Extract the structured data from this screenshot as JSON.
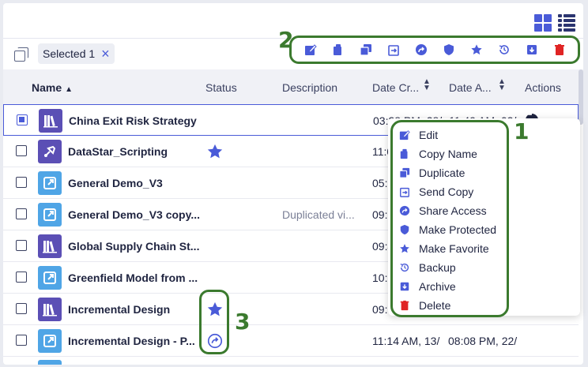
{
  "toolbar": {
    "selected_chip": "Selected 1",
    "chip_close": "×",
    "icons": [
      "edit-icon",
      "copy-icon",
      "duplicate-icon",
      "send-copy-icon",
      "share-icon",
      "shield-icon",
      "star-icon",
      "backup-icon",
      "archive-icon",
      "delete-icon"
    ]
  },
  "table": {
    "headers": {
      "name": "Name",
      "status": "Status",
      "description": "Description",
      "date_created": "Date Cr...",
      "date_accessed": "Date A...",
      "actions": "Actions"
    },
    "rows": [
      {
        "name": "China Exit Risk Strategy",
        "icon": "library-icon",
        "status": "",
        "description": "",
        "date_created": "03:38 PM, 28/",
        "date_accessed": "11:49 AM, 02/",
        "selected": true
      },
      {
        "name": "DataStar_Scripting",
        "icon": "rocket-icon",
        "status": "favorite",
        "description": "",
        "date_created": "11:0",
        "date_accessed": "",
        "selected": false
      },
      {
        "name": "General Demo_V3",
        "icon": "external-link-icon",
        "status": "",
        "description": "",
        "date_created": "05:1",
        "date_accessed": "",
        "selected": false
      },
      {
        "name": "General Demo_V3 copy...",
        "icon": "external-link-icon",
        "status": "",
        "description": "Duplicated vi...",
        "date_created": "09:5",
        "date_accessed": "",
        "selected": false
      },
      {
        "name": "Global Supply Chain St...",
        "icon": "library-icon",
        "status": "",
        "description": "",
        "date_created": "09:4",
        "date_accessed": "",
        "selected": false
      },
      {
        "name": "Greenfield Model from ...",
        "icon": "external-link-icon",
        "status": "",
        "description": "",
        "date_created": "10:2",
        "date_accessed": "",
        "selected": false
      },
      {
        "name": "Incremental Design",
        "icon": "library-icon",
        "status": "favorite",
        "description": "",
        "date_created": "09:5",
        "date_accessed": "",
        "selected": false
      },
      {
        "name": "Incremental Design - P...",
        "icon": "external-link-icon",
        "status": "shared",
        "description": "",
        "date_created": "11:14 AM, 13/",
        "date_accessed": "08:08 PM, 22/",
        "selected": false
      }
    ]
  },
  "context_menu": {
    "items": [
      {
        "label": "Edit",
        "icon": "edit-icon"
      },
      {
        "label": "Copy Name",
        "icon": "copy-icon"
      },
      {
        "label": "Duplicate",
        "icon": "duplicate-icon"
      },
      {
        "label": "Send Copy",
        "icon": "send-copy-icon"
      },
      {
        "label": "Share Access",
        "icon": "share-icon"
      },
      {
        "label": "Make Protected",
        "icon": "shield-icon"
      },
      {
        "label": "Make Favorite",
        "icon": "star-icon"
      },
      {
        "label": "Backup",
        "icon": "backup-icon"
      },
      {
        "label": "Archive",
        "icon": "archive-icon"
      },
      {
        "label": "Delete",
        "icon": "delete-icon"
      }
    ]
  },
  "callouts": {
    "one": "1",
    "two": "2",
    "three": "3"
  },
  "colors": {
    "accent": "#4a5bd8",
    "annotation": "#3b7a2e",
    "delete": "#e02424",
    "header_bg": "#f0f1f6"
  }
}
